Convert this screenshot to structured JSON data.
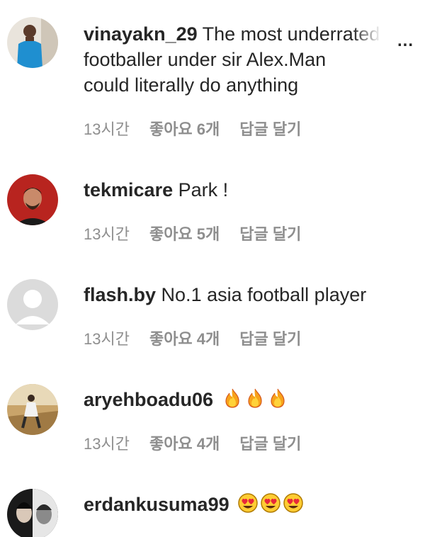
{
  "comments": [
    {
      "username": "vinayakn_29",
      "text_line1": "The most underrated",
      "text_line2": "footballer under sir Alex.Man",
      "text_line3": "could literally do anything",
      "time": "13시간",
      "likes": "좋아요 6개",
      "reply": "답글 달기",
      "more": "..."
    },
    {
      "username": "tekmicare",
      "text": "Park !",
      "time": "13시간",
      "likes": "좋아요 5개",
      "reply": "답글 달기"
    },
    {
      "username": "flash.by",
      "text": "No.1 asia football player",
      "time": "13시간",
      "likes": "좋아요 4개",
      "reply": "답글 달기"
    },
    {
      "username": "aryehboadu06",
      "emojis": [
        "fire-emoji",
        "fire-emoji",
        "fire-emoji"
      ],
      "time": "13시간",
      "likes": "좋아요 4개",
      "reply": "답글 달기"
    },
    {
      "username": "erdankusuma99",
      "emojis": [
        "heart-eyes-emoji",
        "heart-eyes-emoji",
        "heart-eyes-emoji"
      ]
    }
  ],
  "colors": {
    "text": "#262626",
    "meta": "#8e8e8e",
    "default_avatar": "#dbdbdb"
  }
}
